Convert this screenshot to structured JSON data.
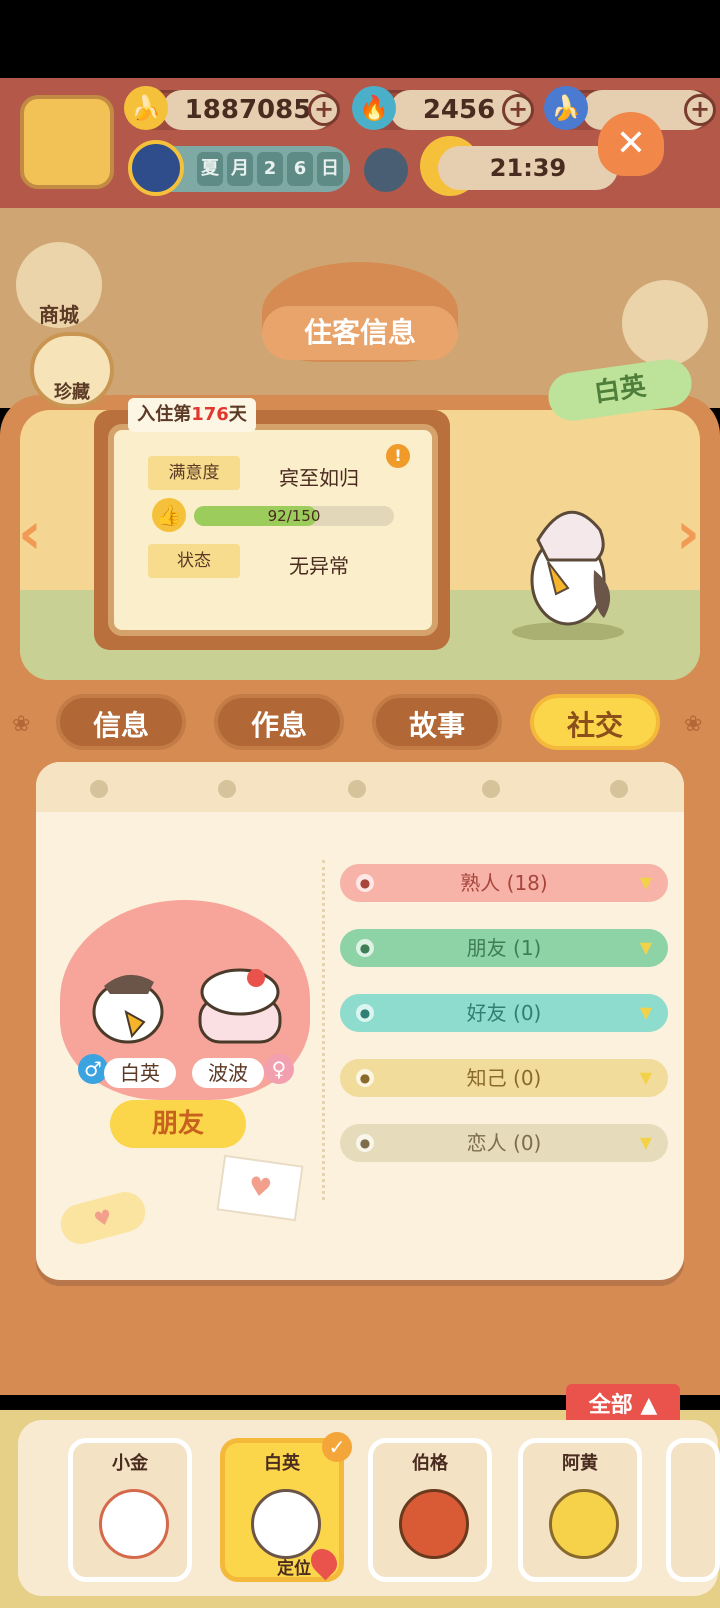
{
  "hud": {
    "bananas": "1887085",
    "flames": "2456",
    "date_chars": [
      "夏",
      "月",
      "2",
      "6",
      "日"
    ],
    "time": "21:39"
  },
  "side_buttons": {
    "shop": "商城",
    "collection": "珍藏"
  },
  "panel": {
    "title": "住客信息",
    "resident_name": "白英",
    "stay_prefix": "入住第",
    "stay_days": "176",
    "stay_suffix": "天",
    "satisfaction_label": "满意度",
    "satisfaction_value": "宾至如归",
    "progress_text": "92/150",
    "progress_fraction": 0.613,
    "status_label": "状态",
    "status_value": "无异常"
  },
  "tabs": [
    "信息",
    "作息",
    "故事",
    "社交"
  ],
  "active_tab": "社交",
  "social": {
    "relations": [
      {
        "label": "熟人 (18)",
        "color": "#f7b3a8",
        "text_color": "#a8463d"
      },
      {
        "label": "朋友 (1)",
        "color": "#8ed3a5",
        "text_color": "#3f7d55"
      },
      {
        "label": "好友 (0)",
        "color": "#8ddccd",
        "text_color": "#2f7f74"
      },
      {
        "label": "知己 (0)",
        "color": "#f1dc9b",
        "text_color": "#8a6a2c"
      },
      {
        "label": "恋人 (0)",
        "color": "#e6dcbb",
        "text_color": "#7d6d4b"
      }
    ],
    "pair_left": "白英",
    "pair_right": "波波",
    "pair_relation": "朋友"
  },
  "bottom": {
    "filter_label": "全部",
    "residents": [
      "小金",
      "白英",
      "伯格",
      "阿黄"
    ],
    "locate_label": "定位"
  },
  "colors": {
    "accent": "#fbd54a",
    "panel": "#d68b52"
  }
}
